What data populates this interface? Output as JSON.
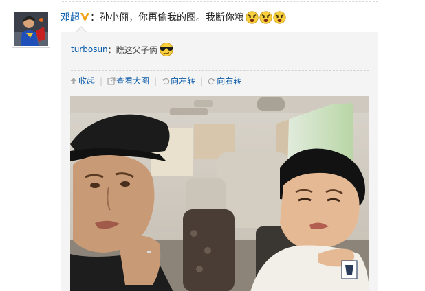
{
  "post": {
    "author": "邓超",
    "separator": "：",
    "text": "孙小俪，你再偷我的图。我断你粮",
    "emojis": [
      "angry-face-icon",
      "angry-face-icon",
      "angry-face-icon"
    ]
  },
  "repost": {
    "author": "turbosun",
    "separator": "：",
    "text": "瞧这父子俩",
    "emoji": "sunglasses-face-icon"
  },
  "actions": {
    "collapse": "收起",
    "view_large": "查看大图",
    "rotate_left": "向左转",
    "rotate_right": "向右转"
  },
  "colors": {
    "link": "#0a5aa8",
    "repost_bg": "#f4f4f4",
    "verified_badge": "#f2a51a"
  }
}
